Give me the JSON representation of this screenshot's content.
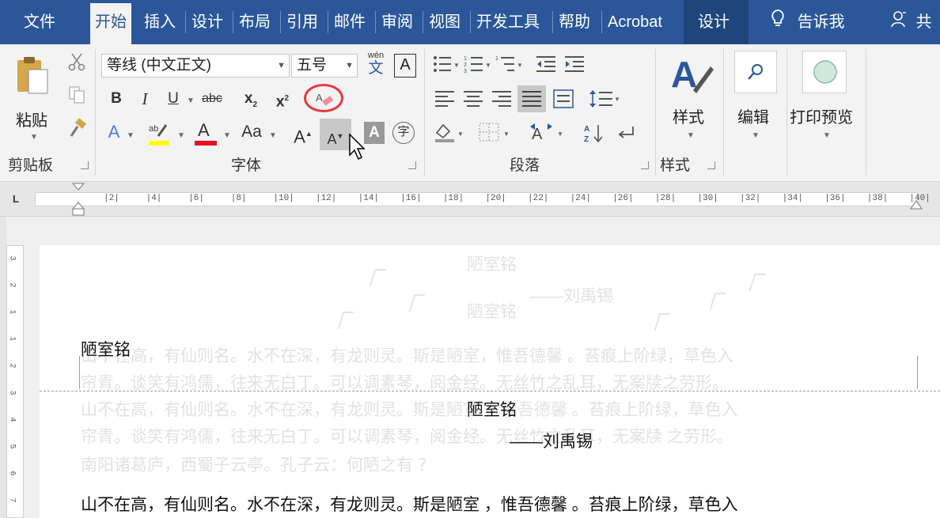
{
  "tabs": [
    {
      "label": "文件",
      "active": false
    },
    {
      "label": "开始",
      "active": true
    },
    {
      "label": "插入",
      "active": false
    },
    {
      "label": "设计",
      "active": false
    },
    {
      "label": "布局",
      "active": false
    },
    {
      "label": "引用",
      "active": false
    },
    {
      "label": "邮件",
      "active": false
    },
    {
      "label": "审阅",
      "active": false
    },
    {
      "label": "视图",
      "active": false
    },
    {
      "label": "开发工具",
      "active": false
    },
    {
      "label": "帮助",
      "active": false
    },
    {
      "label": "Acrobat",
      "active": false
    },
    {
      "label": "设计",
      "active": false
    },
    {
      "label": "告诉我",
      "active": false
    },
    {
      "label": "共",
      "active": false
    }
  ],
  "ribbon": {
    "clipboard": {
      "paste_label": "粘贴",
      "group_label": "剪贴板"
    },
    "font": {
      "font_name": "等线 (中文正文)",
      "font_size": "五号",
      "phonetic_top": "wén",
      "phonetic_bottom": "文",
      "border_char": "A",
      "bold": "B",
      "italic": "I",
      "underline": "U",
      "strike": "abc",
      "subscript": "x",
      "superscript": "x",
      "change_case": "Aa",
      "grow": "A",
      "shrink": "A",
      "shading": "A",
      "enclose": "字",
      "group_label": "字体"
    },
    "paragraph": {
      "group_label": "段落"
    },
    "styles": {
      "label": "样式",
      "group_label": "样式"
    },
    "editing": {
      "label": "编辑"
    },
    "print_preview": {
      "label": "打印预览"
    }
  },
  "ruler": {
    "corner": "L",
    "ticks": [
      "2",
      "4",
      "6",
      "8",
      "10",
      "12",
      "14",
      "16",
      "18",
      "20",
      "22",
      "24",
      "26",
      "28",
      "30",
      "32",
      "34",
      "36",
      "38",
      "40"
    ]
  },
  "vruler": {
    "ticks": [
      "3",
      "2",
      "1",
      "1",
      "2",
      "3",
      "4",
      "5",
      "6",
      "7"
    ]
  },
  "document": {
    "header_title": "陋室铭",
    "title": "陋室铭",
    "author": "——刘禹锡",
    "body_line1": "山不在高，有仙则名。水不在深，有龙则灵。斯是陋室 ，惟吾德馨 。苔痕上阶绿，草色入"
  },
  "colors": {
    "tab_bar": "#2b579a",
    "ribbon_bg": "#f3f3f3",
    "highlight_circle": "#e8383d",
    "font_color_red": "#e81123",
    "highlight_yellow": "#ffff00"
  }
}
